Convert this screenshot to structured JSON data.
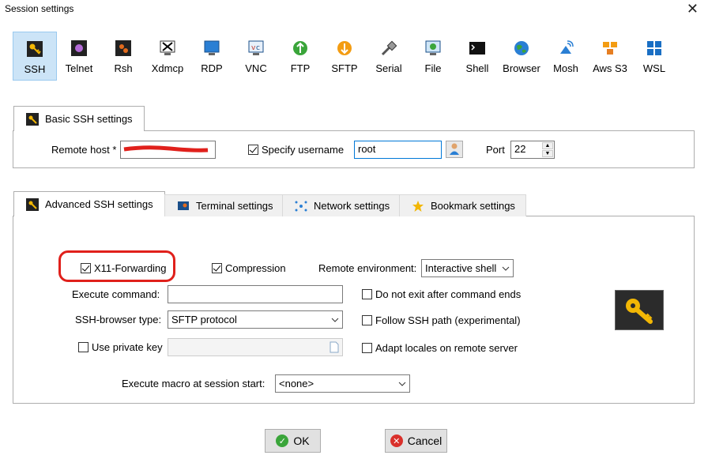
{
  "window": {
    "title": "Session settings"
  },
  "protocols": [
    {
      "label": "SSH",
      "icon": "key-icon",
      "selected": true
    },
    {
      "label": "Telnet",
      "icon": "telnet-icon"
    },
    {
      "label": "Rsh",
      "icon": "rsh-icon"
    },
    {
      "label": "Xdmcp",
      "icon": "xdmcp-icon"
    },
    {
      "label": "RDP",
      "icon": "rdp-icon"
    },
    {
      "label": "VNC",
      "icon": "vnc-icon"
    },
    {
      "label": "FTP",
      "icon": "ftp-icon"
    },
    {
      "label": "SFTP",
      "icon": "sftp-icon"
    },
    {
      "label": "Serial",
      "icon": "serial-icon"
    },
    {
      "label": "File",
      "icon": "file-icon"
    },
    {
      "label": "Shell",
      "icon": "shell-icon"
    },
    {
      "label": "Browser",
      "icon": "browser-icon"
    },
    {
      "label": "Mosh",
      "icon": "mosh-icon"
    },
    {
      "label": "Aws S3",
      "icon": "aws-s3-icon"
    },
    {
      "label": "WSL",
      "icon": "wsl-icon"
    }
  ],
  "basic": {
    "tab_label": "Basic SSH settings",
    "remote_host_label": "Remote host *",
    "specify_username_label": "Specify username",
    "specify_username_checked": true,
    "username_value": "root",
    "port_label": "Port",
    "port_value": "22"
  },
  "advanced_tabs": [
    {
      "label": "Advanced SSH settings",
      "active": true
    },
    {
      "label": "Terminal settings"
    },
    {
      "label": "Network settings"
    },
    {
      "label": "Bookmark settings"
    }
  ],
  "advanced": {
    "x11_label": "X11-Forwarding",
    "x11_checked": true,
    "compression_label": "Compression",
    "compression_checked": true,
    "remote_env_label": "Remote environment:",
    "remote_env_value": "Interactive shell",
    "execute_command_label": "Execute command:",
    "do_not_exit_label": "Do not exit after command ends",
    "browser_type_label": "SSH-browser type:",
    "browser_type_value": "SFTP protocol",
    "follow_ssh_path_label": "Follow SSH path (experimental)",
    "use_private_key_label": "Use private key",
    "adapt_locales_label": "Adapt locales on remote server",
    "macro_label": "Execute macro at session start:",
    "macro_value": "<none>"
  },
  "buttons": {
    "ok": "OK",
    "cancel": "Cancel"
  },
  "colors": {
    "highlight_ring": "#e0201b",
    "selection": "#cce4f7",
    "key_panel": "#2b2b2b",
    "key_gold": "#f2b705"
  }
}
